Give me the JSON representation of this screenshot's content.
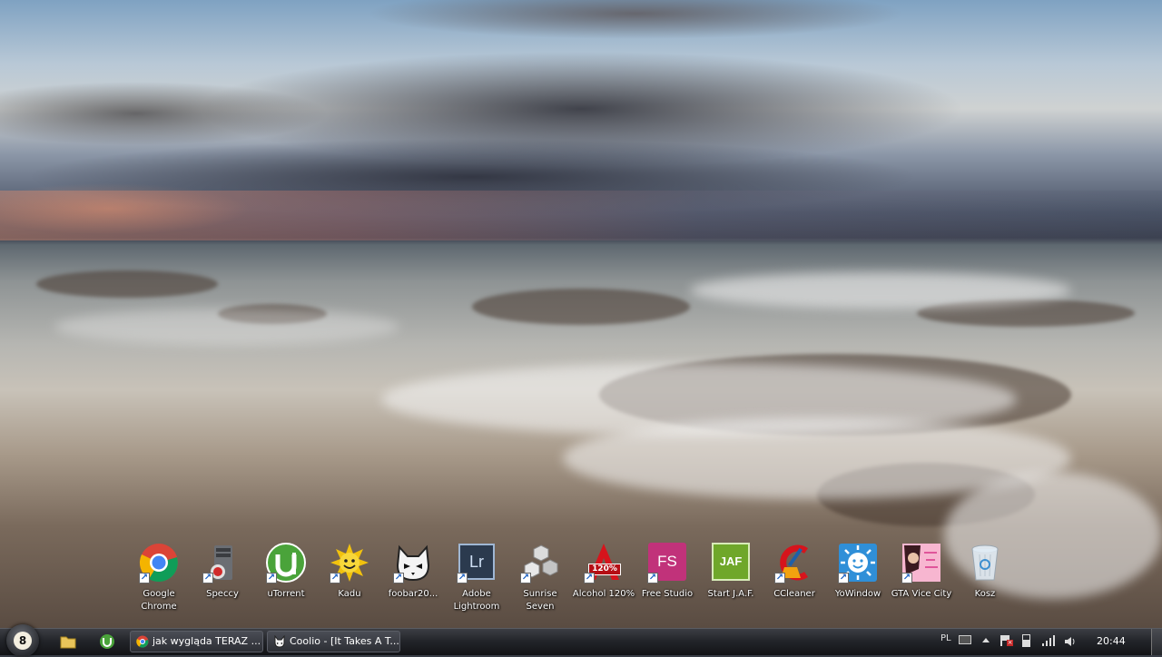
{
  "desktop": {
    "icons": [
      {
        "label": "Google Chrome",
        "icon": "chrome-icon"
      },
      {
        "label": "Speccy",
        "icon": "speccy-icon"
      },
      {
        "label": "uTorrent",
        "icon": "utorrent-icon"
      },
      {
        "label": "Kadu",
        "icon": "kadu-sun-icon"
      },
      {
        "label": "foobar20...",
        "icon": "foobar-cat-icon"
      },
      {
        "label": "Adobe Lightroom",
        "icon": "lightroom-icon",
        "badge": "Lr"
      },
      {
        "label": "Sunrise Seven",
        "icon": "hexagons-icon"
      },
      {
        "label": "Alcohol 120%",
        "icon": "alcohol-icon",
        "badge": "120%"
      },
      {
        "label": "Free Studio",
        "icon": "freestudio-icon",
        "badge": "FS"
      },
      {
        "label": "Start J.A.F.",
        "icon": "jaf-icon",
        "badge": "JAF"
      },
      {
        "label": "CCleaner",
        "icon": "ccleaner-icon"
      },
      {
        "label": "YoWindow",
        "icon": "yowindow-icon"
      },
      {
        "label": "GTA Vice City",
        "icon": "gta-icon"
      },
      {
        "label": "Kosz",
        "icon": "recycle-bin-icon"
      }
    ]
  },
  "taskbar": {
    "start_badge": "8",
    "windows": [
      {
        "label": "jak wygląda TERAZ ...",
        "icon": "chrome-icon"
      },
      {
        "label": "Coolio - [It Takes A T...",
        "icon": "foobar-cat-icon"
      }
    ],
    "tray": {
      "language": "PL",
      "clock": "20:44"
    }
  },
  "colors": {
    "taskbar": "#1c1d21",
    "chrome_red": "#db4437",
    "chrome_green": "#0f9d58",
    "chrome_yellow": "#f4b400",
    "chrome_blue": "#4285f4",
    "utorrent_green": "#4aa33a",
    "lightroom_blue": "#2b3a4e",
    "freestudio_pink": "#c1327a",
    "jaf_green": "#6fa72a",
    "yowindow_blue": "#2f8fd8"
  }
}
